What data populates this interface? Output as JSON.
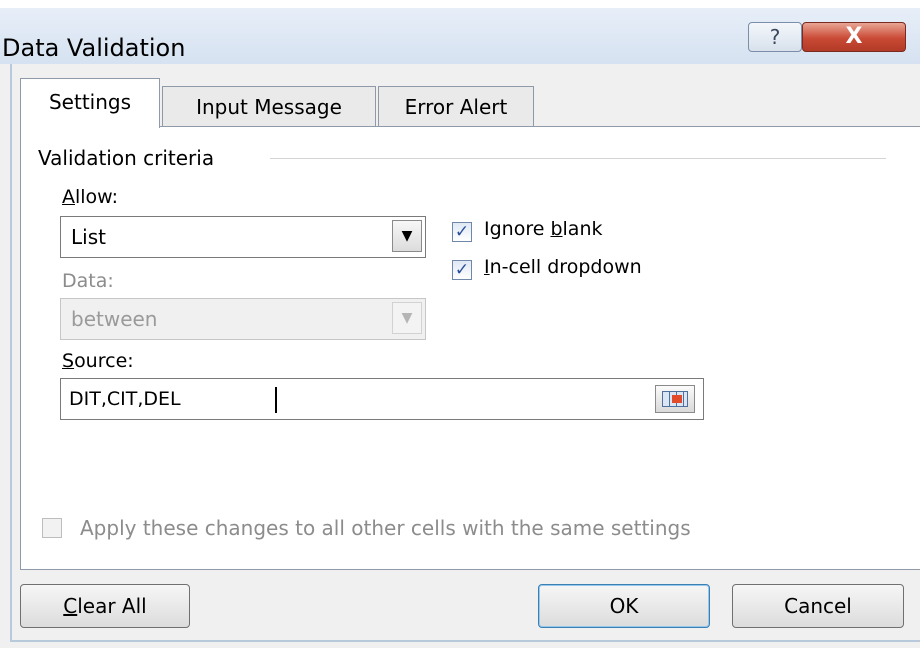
{
  "window": {
    "title": "Data Validation",
    "help_glyph": "?",
    "close_glyph": "X"
  },
  "tabs": [
    {
      "label": "Settings",
      "active": true
    },
    {
      "label": "Input Message",
      "active": false
    },
    {
      "label": "Error Alert",
      "active": false
    }
  ],
  "criteria": {
    "group_label": "Validation criteria",
    "allow": {
      "accel": "A",
      "rest": "llow:",
      "value": "List"
    },
    "data": {
      "label": "Data:",
      "value": "between"
    },
    "source": {
      "accel": "S",
      "rest": "ource:",
      "value": "DIT,CIT,DEL"
    },
    "ignore_blank": {
      "pre": "Ignore ",
      "accel": "b",
      "post": "lank",
      "checked": true
    },
    "in_cell_dropdown": {
      "accel": "I",
      "post": "n-cell dropdown",
      "checked": true
    }
  },
  "apply_all": {
    "label": "Apply these changes to all other cells with the same settings",
    "checked": false
  },
  "buttons": {
    "clear_all": {
      "accel": "C",
      "rest": "lear All"
    },
    "ok": "OK",
    "cancel": "Cancel"
  },
  "icons": {
    "dropdown": "chevron-down-icon",
    "range_select": "range-select-icon",
    "checkmark": "checkmark-icon"
  }
}
